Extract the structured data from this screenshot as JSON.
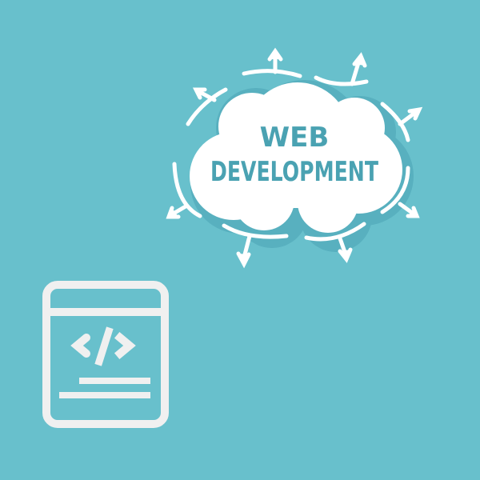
{
  "cloud": {
    "line1": "WEB",
    "line2": "DEVELOPMENT"
  },
  "colors": {
    "background": "#68c0cc",
    "cloud_text": "#4aa2b2",
    "icon": "#f0f0f0",
    "cloud_shadow": "#58b0bf"
  },
  "icons": [
    "cloud-icon",
    "code-window-icon",
    "arrow-icon"
  ]
}
